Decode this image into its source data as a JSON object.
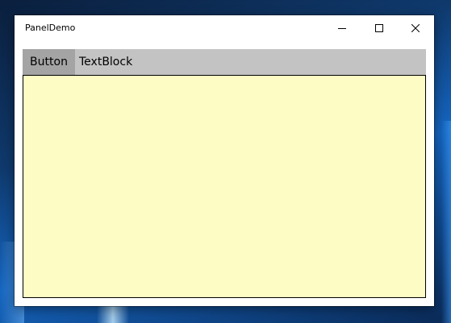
{
  "window": {
    "title": "PanelDemo"
  },
  "caption_buttons": {
    "minimize_icon": "minimize-icon",
    "maximize_icon": "maximize-icon",
    "close_icon": "close-icon"
  },
  "panel": {
    "button_label": "Button",
    "textblock_text": "TextBlock"
  },
  "colors": {
    "topbar": "#c3c3c3",
    "button_bg": "#a4a4a4",
    "content_bg": "#fcfcc4"
  }
}
